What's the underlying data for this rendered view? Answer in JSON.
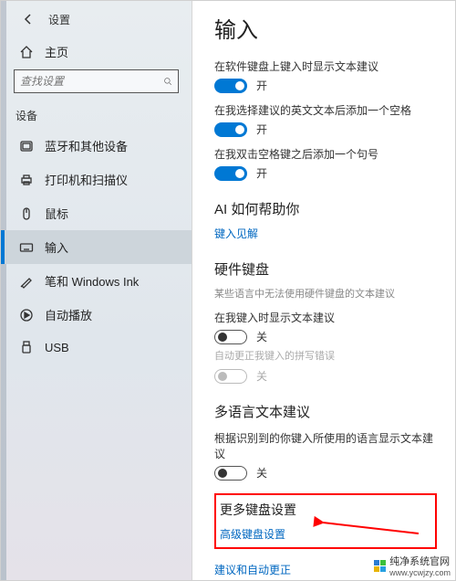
{
  "header": {
    "app_title": "设置"
  },
  "sidebar": {
    "home_label": "主页",
    "search_placeholder": "查找设置",
    "section_label": "设备",
    "items": [
      {
        "label": "蓝牙和其他设备"
      },
      {
        "label": "打印机和扫描仪"
      },
      {
        "label": "鼠标"
      },
      {
        "label": "输入"
      },
      {
        "label": "笔和 Windows Ink"
      },
      {
        "label": "自动播放"
      },
      {
        "label": "USB"
      }
    ]
  },
  "main": {
    "title": "输入",
    "settings": [
      {
        "label": "在软件键盘上键入时显示文本建议",
        "state": "on",
        "state_text": "开"
      },
      {
        "label": "在我选择建议的英文文本后添加一个空格",
        "state": "on",
        "state_text": "开"
      },
      {
        "label": "在我双击空格键之后添加一个句号",
        "state": "on",
        "state_text": "开"
      }
    ],
    "ai": {
      "heading": "AI 如何帮助你",
      "link": "键入见解"
    },
    "hw": {
      "heading": "硬件键盘",
      "subtext": "某些语言中无法使用硬件键盘的文本建议",
      "item1": {
        "label": "在我键入时显示文本建议",
        "state": "off",
        "state_text": "关"
      },
      "item2": {
        "label": "自动更正我键入的拼写错误",
        "state": "disabled",
        "state_text": "关"
      }
    },
    "multi": {
      "heading": "多语言文本建议",
      "label": "根据识别到的你键入所使用的语言显示文本建议",
      "state": "off",
      "state_text": "关"
    },
    "more": {
      "heading": "更多键盘设置",
      "link": "高级键盘设置"
    },
    "bottom_link": "建议和自动更正"
  },
  "watermark": {
    "brand": "纯净系统官网",
    "url": "www.ycwjzy.com"
  }
}
